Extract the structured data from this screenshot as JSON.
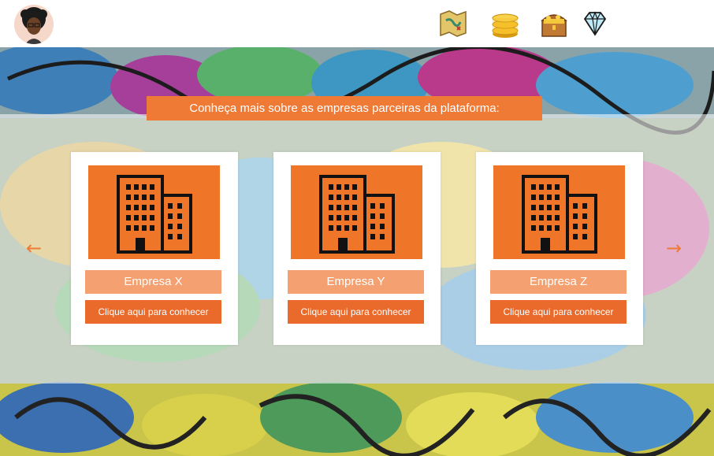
{
  "header": {
    "avatar_icon": "user-avatar",
    "hud_icons": [
      "treasure-map-icon",
      "coins-icon",
      "treasure-chest-icon",
      "diamond-icon"
    ]
  },
  "banner": {
    "text": "Conheça mais sobre as empresas parceiras da plataforma:"
  },
  "carousel": {
    "prev_arrow": "←",
    "next_arrow": "→",
    "cards": [
      {
        "name": "Empresa X",
        "button": "Clique aqui para conhecer",
        "icon": "building-icon"
      },
      {
        "name": "Empresa Y",
        "button": "Clique aqui para conhecer",
        "icon": "building-icon"
      },
      {
        "name": "Empresa Z",
        "button": "Clique aqui para conhecer",
        "icon": "building-icon"
      }
    ]
  },
  "colors": {
    "accent": "#ef7a36",
    "card_image": "#ef7628",
    "card_name": "#f4a070",
    "card_button": "#ea6a2c"
  }
}
